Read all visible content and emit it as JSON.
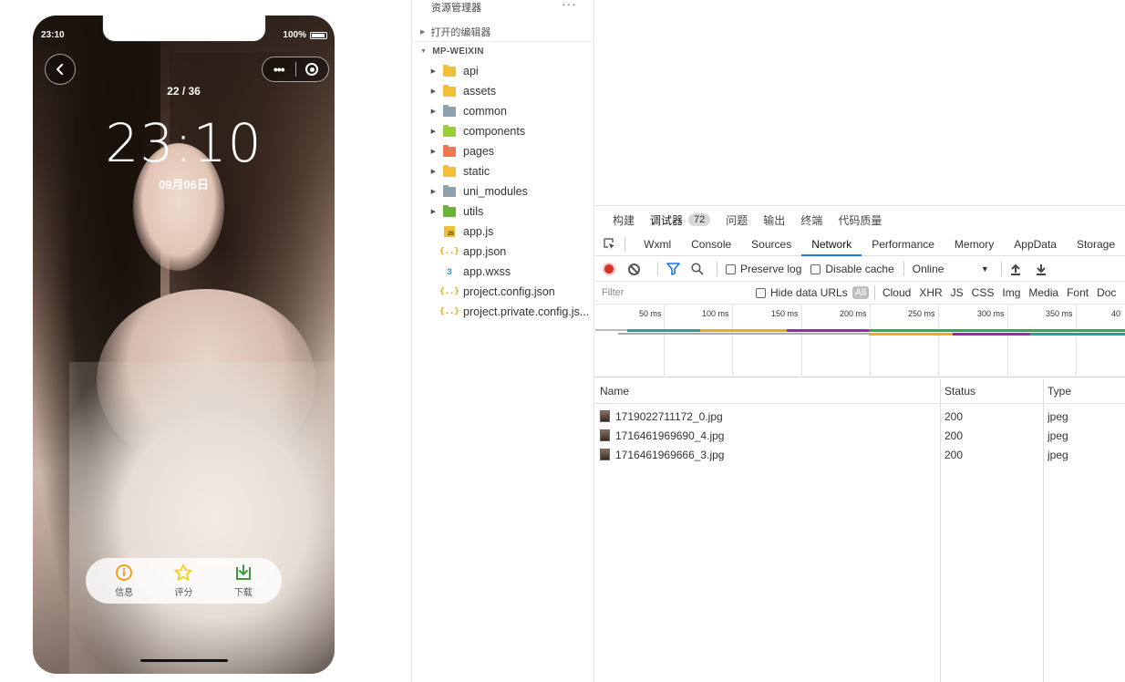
{
  "simulator": {
    "status_time": "23:10",
    "battery": "100%",
    "counter": "22 / 36",
    "clock": "23:10",
    "date": "09月06日",
    "actions": [
      {
        "label": "信息",
        "icon": "info-icon",
        "color": "#f0a020"
      },
      {
        "label": "评分",
        "icon": "star-icon",
        "color": "#f0d020"
      },
      {
        "label": "下载",
        "icon": "download-icon",
        "color": "#3a9a3a"
      }
    ]
  },
  "explorer": {
    "title": "资源管理器",
    "more": "···",
    "open_editors": "打开的编辑器",
    "project": "MP-WEIXIN",
    "items": [
      {
        "name": "api",
        "kind": "folder",
        "icon": "folder-api-icon",
        "color": "#f2c037"
      },
      {
        "name": "assets",
        "kind": "folder",
        "icon": "folder-assets-icon",
        "color": "#f2c037"
      },
      {
        "name": "common",
        "kind": "folder",
        "icon": "folder-icon",
        "color": "#8fa0b0"
      },
      {
        "name": "components",
        "kind": "folder",
        "icon": "folder-components-icon",
        "color": "#9ccc3a"
      },
      {
        "name": "pages",
        "kind": "folder",
        "icon": "folder-pages-icon",
        "color": "#f07850"
      },
      {
        "name": "static",
        "kind": "folder",
        "icon": "folder-static-icon",
        "color": "#f2c037"
      },
      {
        "name": "uni_modules",
        "kind": "folder",
        "icon": "folder-icon",
        "color": "#8fa0b0"
      },
      {
        "name": "utils",
        "kind": "folder",
        "icon": "folder-utils-icon",
        "color": "#6cb33e"
      },
      {
        "name": "app.js",
        "kind": "js",
        "icon": "js-file-icon"
      },
      {
        "name": "app.json",
        "kind": "json",
        "icon": "json-file-icon"
      },
      {
        "name": "app.wxss",
        "kind": "css",
        "icon": "css-file-icon"
      },
      {
        "name": "project.config.json",
        "kind": "json",
        "icon": "json-file-icon"
      },
      {
        "name": "project.private.config.js...",
        "kind": "json",
        "icon": "json-file-icon"
      }
    ]
  },
  "devtools": {
    "panel_tabs": [
      "构建",
      "调试器",
      "问题",
      "输出",
      "终端",
      "代码质量"
    ],
    "debugger_badge": "72",
    "tabs": [
      "Wxml",
      "Console",
      "Sources",
      "Network",
      "Performance",
      "Memory",
      "AppData",
      "Storage"
    ],
    "active_tab": "Network",
    "toolbar": {
      "preserve_log": "Preserve log",
      "disable_cache": "Disable cache",
      "throttle": "Online"
    },
    "filter": {
      "placeholder": "Filter",
      "hide_data_urls": "Hide data URLs",
      "types": [
        "All",
        "Cloud",
        "XHR",
        "JS",
        "CSS",
        "Img",
        "Media",
        "Font",
        "Doc"
      ]
    },
    "timeline_ticks": [
      "50 ms",
      "100 ms",
      "150 ms",
      "200 ms",
      "250 ms",
      "300 ms",
      "350 ms",
      "40"
    ],
    "columns": [
      "Name",
      "Status",
      "Type"
    ],
    "requests": [
      {
        "name": "1719022711172_0.jpg",
        "status": "200",
        "type": "jpeg"
      },
      {
        "name": "1716461969690_4.jpg",
        "status": "200",
        "type": "jpeg"
      },
      {
        "name": "1716461969666_3.jpg",
        "status": "200",
        "type": "jpeg"
      }
    ]
  }
}
